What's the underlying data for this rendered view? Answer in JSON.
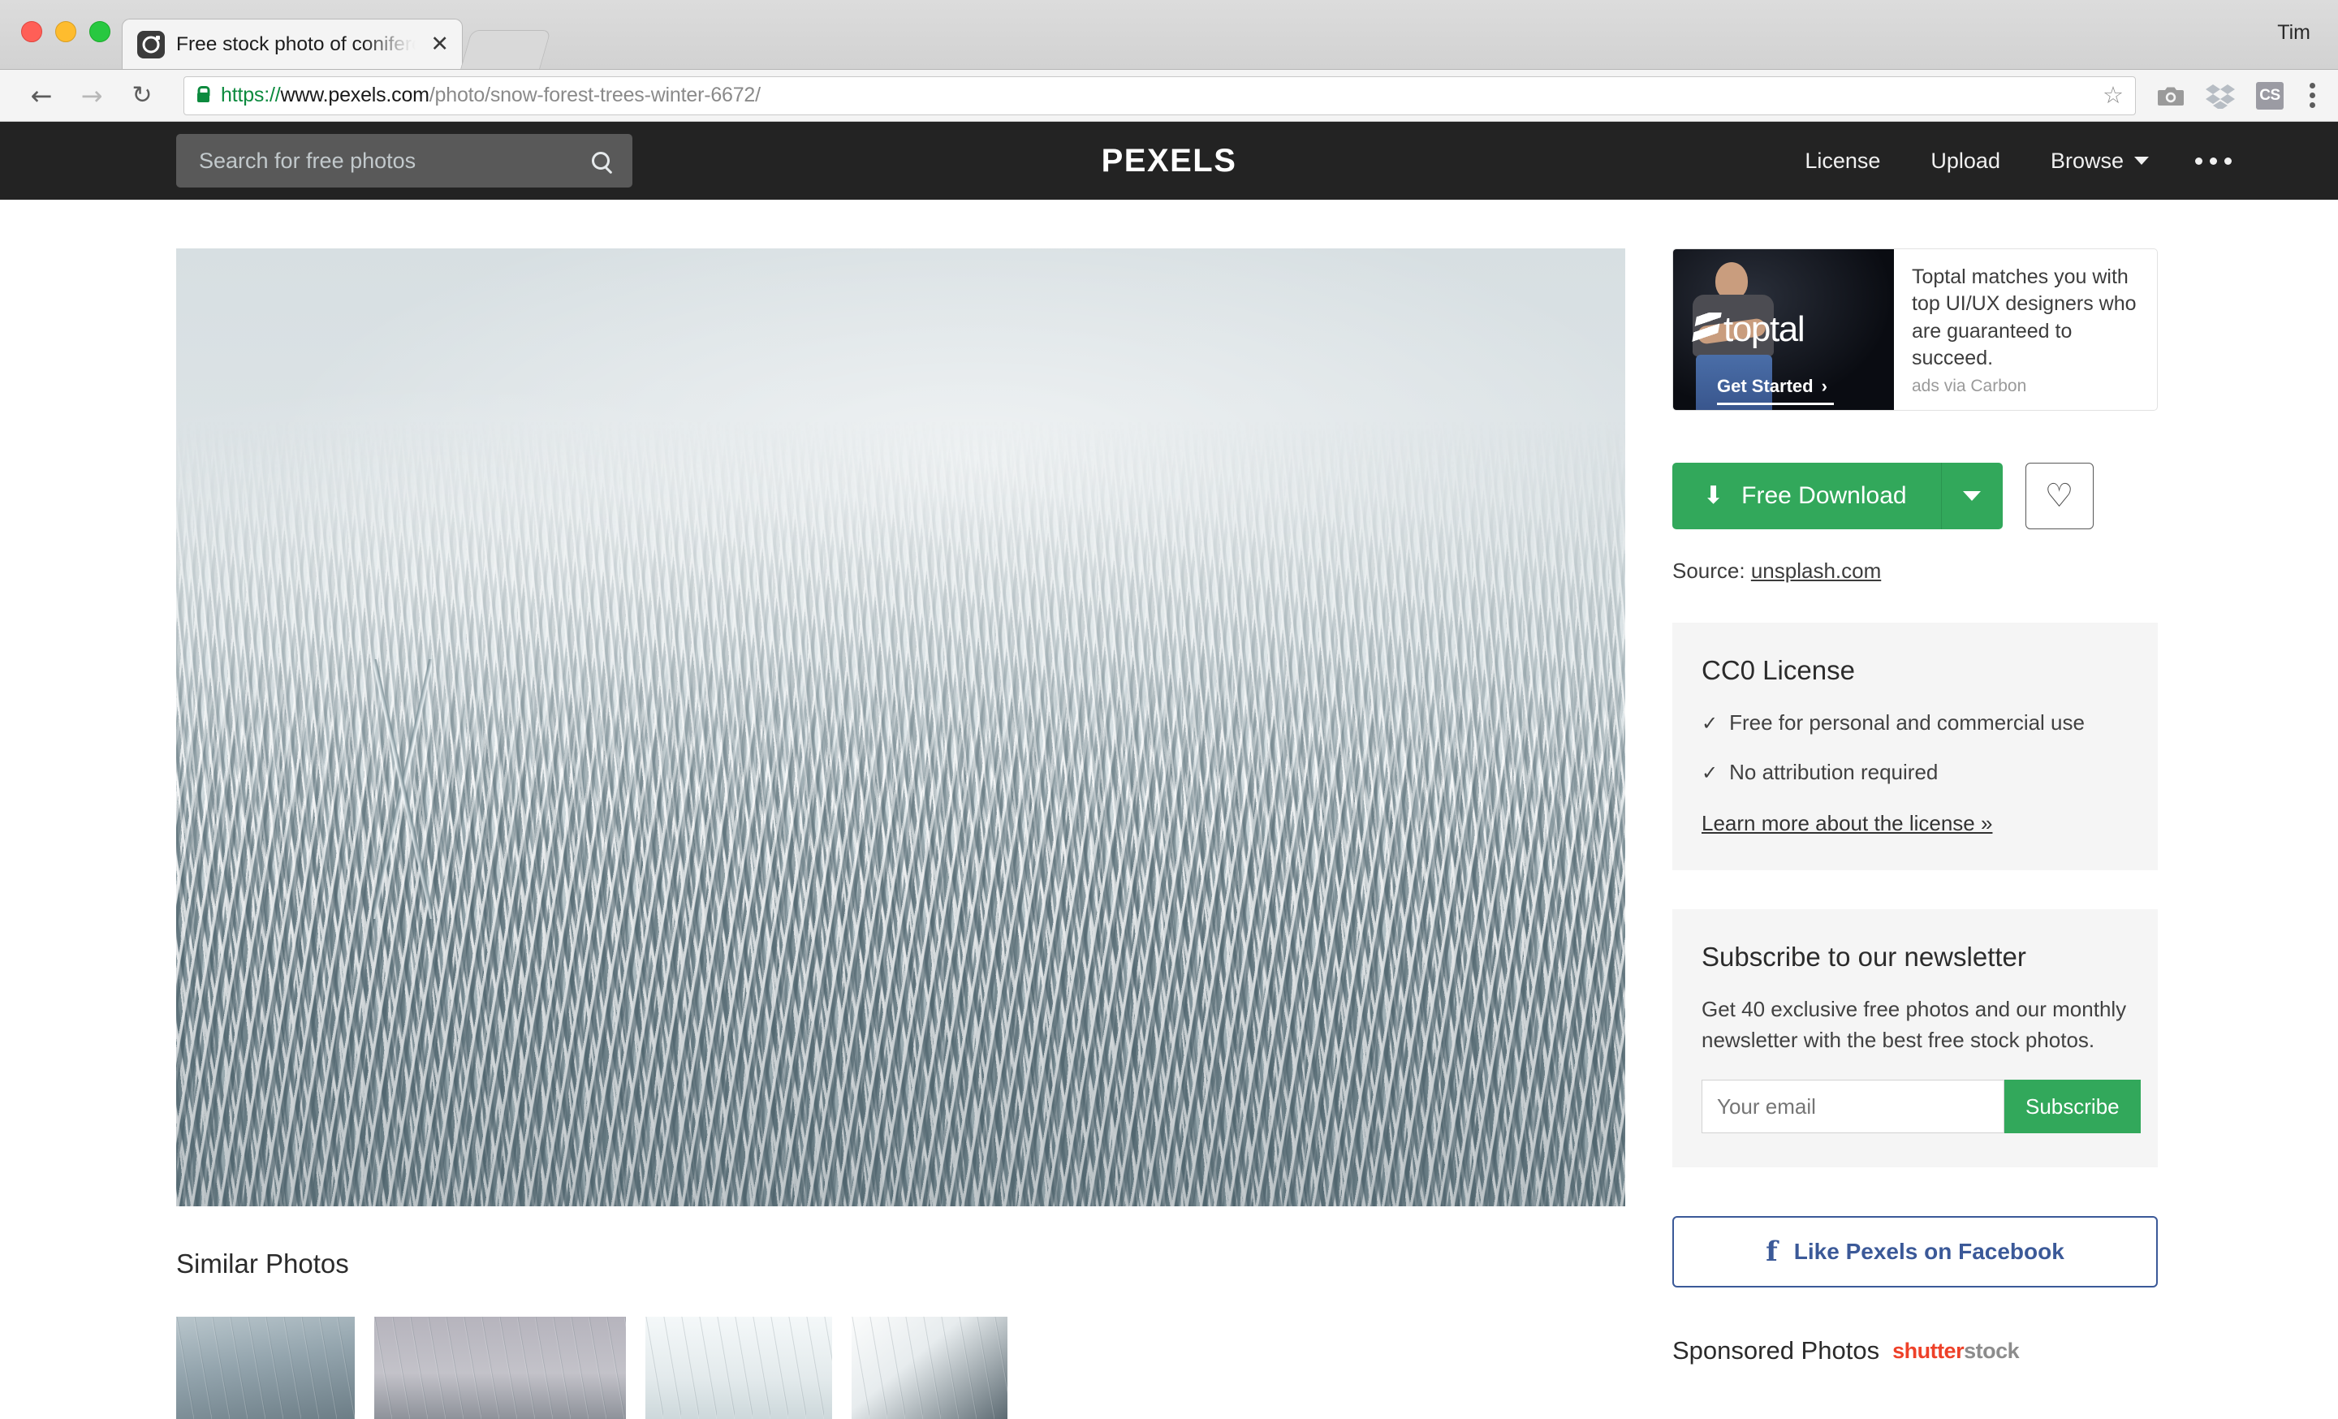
{
  "os": {
    "user_label": "Tim"
  },
  "browser": {
    "tab": {
      "title": "Free stock photo of coniferous",
      "favicon": "camera-icon",
      "close": "✕"
    },
    "nav": {
      "back": "←",
      "forward": "→",
      "reload": "↻"
    },
    "url": {
      "scheme": "https://",
      "host": "www.pexels.com",
      "path": "/photo/snow-forest-trees-winter-6672/",
      "full": "https://www.pexels.com/photo/snow-forest-trees-winter-6672/"
    },
    "bookmark_star": "☆",
    "extensions": [
      "camera-icon",
      "dropbox-icon",
      "cs-badge",
      "kebab-menu-icon"
    ],
    "cs_badge_label": "CS"
  },
  "site_header": {
    "logo": "PEXELS",
    "search_placeholder": "Search for free photos",
    "nav_items": [
      {
        "label": "License",
        "has_caret": false
      },
      {
        "label": "Upload",
        "has_caret": false
      },
      {
        "label": "Browse",
        "has_caret": true
      }
    ],
    "more_menu": "•••"
  },
  "main": {
    "photo_alt": "Snow covered coniferous forest in winter fog",
    "similar_heading": "Similar Photos",
    "thumbnails": [
      {
        "alt": "Foggy winter forest"
      },
      {
        "alt": "Snowy mountain treeline"
      },
      {
        "alt": "Pale snowy conifers"
      },
      {
        "alt": "Snowy mountain ridge"
      }
    ]
  },
  "sidebar": {
    "ad": {
      "brand": "toptal",
      "cta": "Get Started",
      "cta_arrow": "›",
      "text": "Toptal matches you with top UI/UX designers who are guaranteed to succeed.",
      "via": "ads via Carbon"
    },
    "download": {
      "label": "Free Download",
      "arrow_icon": "⬇",
      "dropdown_icon": "chevron-down-icon",
      "favorite_icon": "♡"
    },
    "source": {
      "prefix": "Source: ",
      "link": "unsplash.com"
    },
    "license": {
      "title": "CC0 License",
      "bullets": [
        {
          "check": "✓",
          "text": "Free for personal and commercial use"
        },
        {
          "check": "✓",
          "text": "No attribution required"
        }
      ],
      "learn_more": "Learn more about the license »"
    },
    "newsletter": {
      "title": "Subscribe to our newsletter",
      "body": "Get 40 exclusive free photos and our monthly newsletter with the best free stock photos.",
      "email_placeholder": "Your email",
      "email_value": "",
      "button": "Subscribe"
    },
    "facebook": {
      "icon": "f",
      "label": "Like Pexels on Facebook"
    },
    "sponsored": {
      "label": "Sponsored Photos",
      "brand_a": "shutter",
      "brand_b": "stock"
    }
  },
  "colors": {
    "header_bg": "#232323",
    "accent_green": "#32a85b",
    "facebook_blue": "#3b5998",
    "shutterstock_red": "#ee4129",
    "card_bg": "#f5f5f5"
  }
}
